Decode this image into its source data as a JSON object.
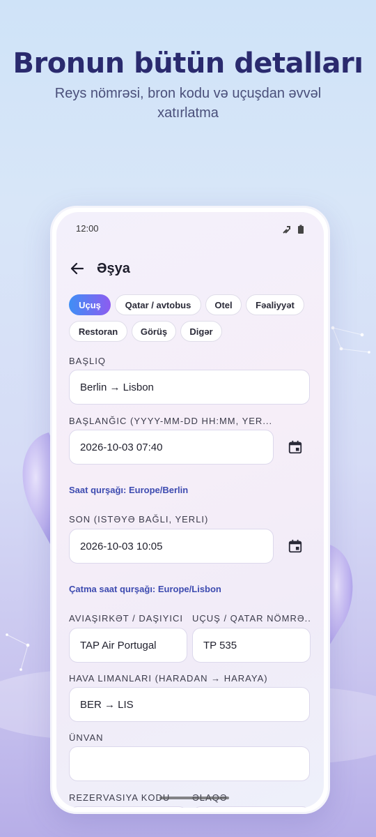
{
  "promo": {
    "title": "Bronun bütün detalları",
    "subtitle": "Reys nömrəsi, bron kodu və uçuşdan əvvəl xatırlatma"
  },
  "status_bar": {
    "time": "12:00",
    "icons": [
      "signal-icon",
      "battery-icon"
    ]
  },
  "app_bar": {
    "title": "Əşya",
    "back_icon": "arrow-left-icon"
  },
  "categories": [
    {
      "label": "Uçuş",
      "selected": true
    },
    {
      "label": "Qatar / avtobus",
      "selected": false
    },
    {
      "label": "Otel",
      "selected": false
    },
    {
      "label": "Fəaliyyət",
      "selected": false
    },
    {
      "label": "Restoran",
      "selected": false
    },
    {
      "label": "Görüş",
      "selected": false
    },
    {
      "label": "Digər",
      "selected": false
    }
  ],
  "form": {
    "title_label": "BAŞLIQ",
    "title_value": "Berlin → Lisbon",
    "start_label": "BAŞLANĞIC (YYYY-MM-DD HH:MM, YER...",
    "start_value": "2026-10-03 07:40",
    "start_timezone": "Saat qurşağı: Europe/Berlin",
    "end_label": "SON (ISTƏYƏ BAĞLI, YERLI)",
    "end_value": "2026-10-03 10:05",
    "end_timezone": "Çatma saat qurşağı: Europe/Lisbon",
    "carrier_label": "AVIAŞIRKƏT / DAŞIYICI",
    "carrier_value": "TAP Air Portugal",
    "flight_label": "UÇUŞ / QATAR NÖMRƏ...",
    "flight_value": "TP 535",
    "airports_label": "HAVA LIMANLARI (HARADAN → HARAYA)",
    "airports_value": "BER → LIS",
    "address_label": "ÜNVAN",
    "address_value": "",
    "booking_label": "REZERVASIYA KODU",
    "contact_label": "ƏLAQƏ"
  },
  "colors": {
    "accent_start": "#3f8ff5",
    "accent_end": "#8d5cf0",
    "headline": "#2a2a6e",
    "timezone_text": "#3d4bb0"
  }
}
